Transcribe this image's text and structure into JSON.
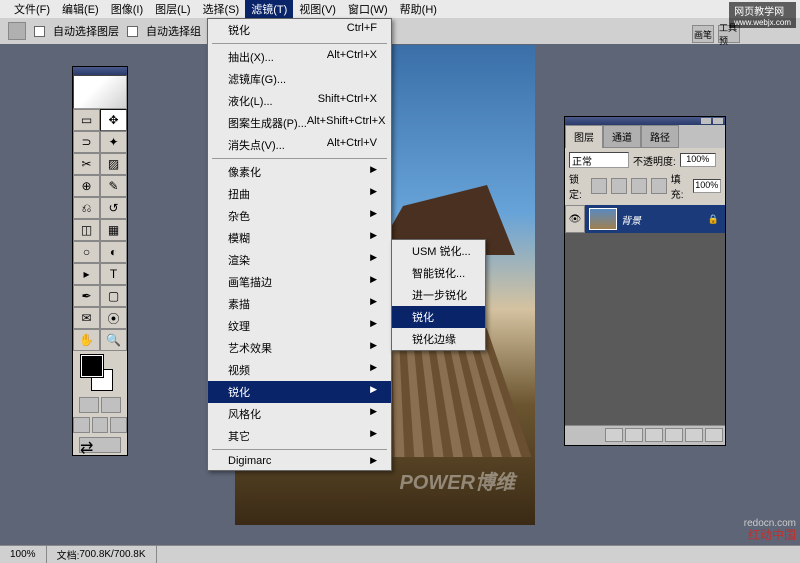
{
  "menubar": {
    "items": [
      "文件(F)",
      "编辑(E)",
      "图像(I)",
      "图层(L)",
      "选择(S)",
      "滤镜(T)",
      "视图(V)",
      "窗口(W)",
      "帮助(H)"
    ],
    "active_index": 5
  },
  "optionsbar": {
    "auto_select_layer": "自动选择图层",
    "auto_select_group": "自动选择组",
    "brush_label": "画笔",
    "tool_preset": "工具预"
  },
  "filter_menu": {
    "last_filter": {
      "label": "锐化",
      "shortcut": "Ctrl+F"
    },
    "items1": [
      {
        "label": "抽出(X)...",
        "shortcut": "Alt+Ctrl+X"
      },
      {
        "label": "滤镜库(G)...",
        "shortcut": ""
      },
      {
        "label": "液化(L)...",
        "shortcut": "Shift+Ctrl+X"
      },
      {
        "label": "图案生成器(P)...",
        "shortcut": "Alt+Shift+Ctrl+X"
      },
      {
        "label": "消失点(V)...",
        "shortcut": "Alt+Ctrl+V"
      }
    ],
    "items2": [
      "像素化",
      "扭曲",
      "杂色",
      "模糊",
      "渲染",
      "画笔描边",
      "素描",
      "纹理",
      "艺术效果",
      "视频",
      "锐化",
      "风格化",
      "其它"
    ],
    "highlighted2": 10,
    "digimarc": "Digimarc"
  },
  "sharpen_submenu": {
    "items": [
      "USM 锐化...",
      "智能锐化...",
      "进一步锐化",
      "锐化",
      "锐化边缘"
    ],
    "highlighted": 3
  },
  "layers_panel": {
    "tabs": [
      "图层",
      "通道",
      "路径"
    ],
    "active_tab": 0,
    "blend_mode": "正常",
    "opacity_label": "不透明度:",
    "opacity_value": "100%",
    "lock_label": "锁定:",
    "fill_label": "填充:",
    "fill_value": "100%",
    "layer_name": "背景"
  },
  "statusbar": {
    "zoom": "100%",
    "doc_label": "文档:",
    "doc_size": "700.8K/700.8K"
  },
  "watermarks": {
    "top": "网页教学网",
    "top_url": "www.webjx.com",
    "canvas": "POWER博维",
    "bottom_cn": "红动中国",
    "bottom_url": "redocn.com"
  }
}
